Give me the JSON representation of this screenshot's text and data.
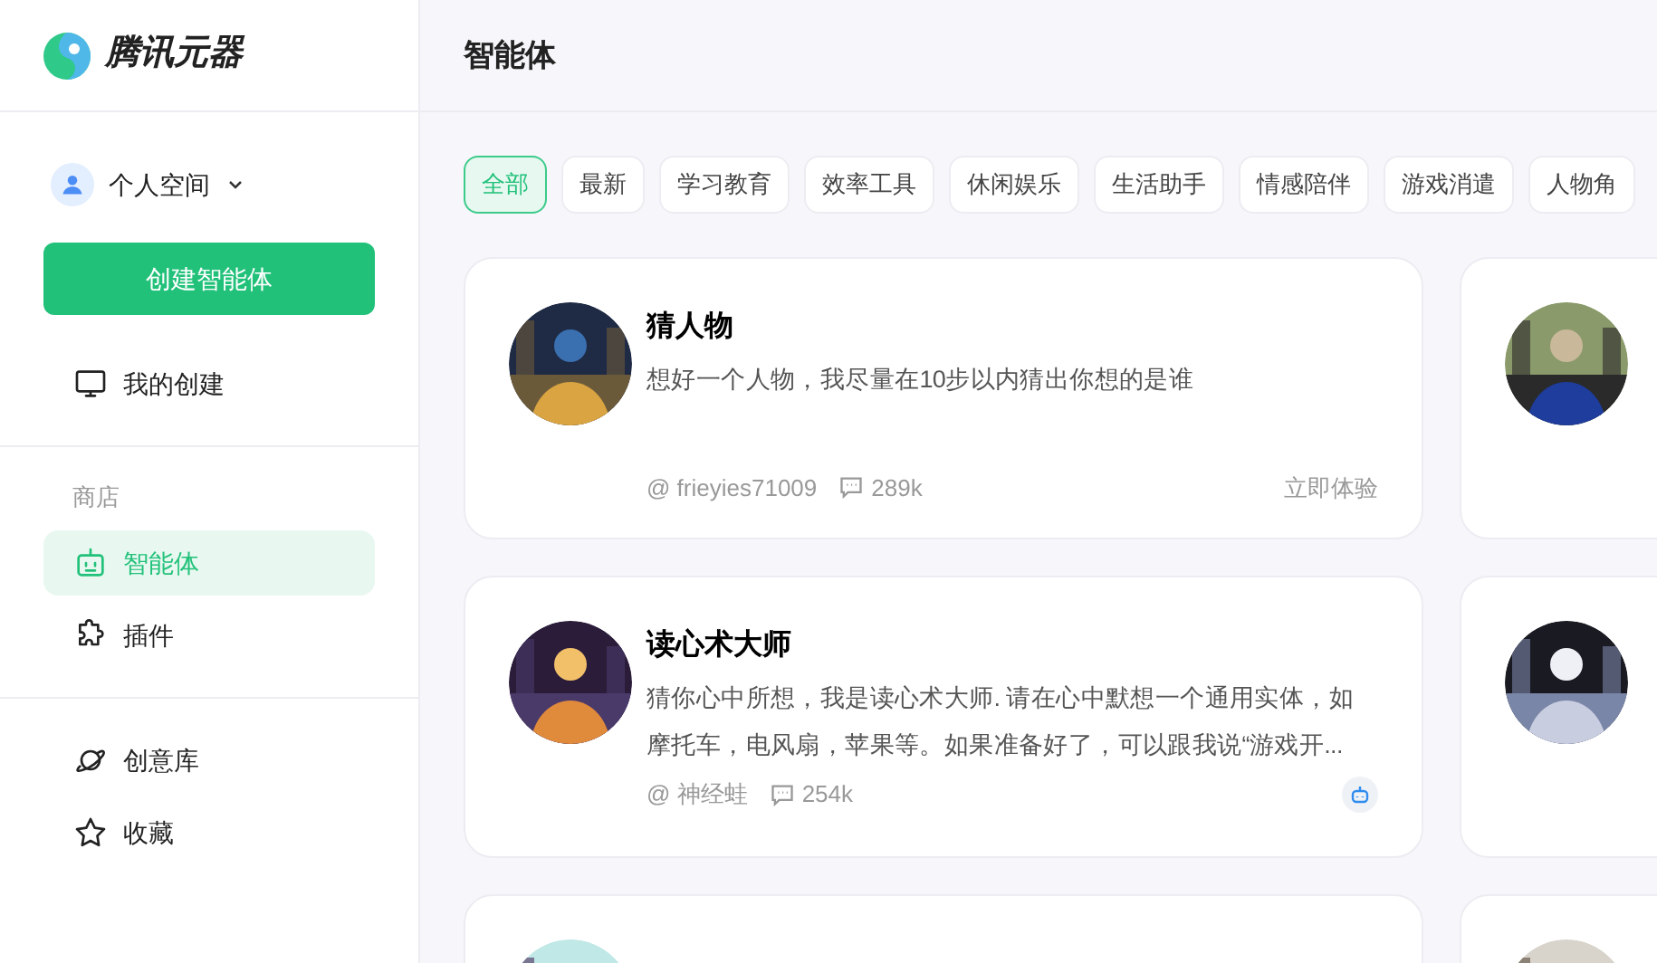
{
  "brand": {
    "name": "腾讯元器"
  },
  "workspace": {
    "label": "个人空间"
  },
  "create_button": "创建智能体",
  "nav_top": [
    {
      "label": "我的创建",
      "selected": false
    }
  ],
  "store": {
    "heading": "商店",
    "items": [
      {
        "label": "智能体",
        "selected": true
      },
      {
        "label": "插件",
        "selected": false
      }
    ]
  },
  "nav_bottom": [
    {
      "label": "创意库",
      "selected": false
    },
    {
      "label": "收藏",
      "selected": false
    }
  ],
  "page_title": "智能体",
  "tags": [
    {
      "label": "全部",
      "selected": true
    },
    {
      "label": "最新",
      "selected": false
    },
    {
      "label": "学习教育",
      "selected": false
    },
    {
      "label": "效率工具",
      "selected": false
    },
    {
      "label": "休闲娱乐",
      "selected": false
    },
    {
      "label": "生活助手",
      "selected": false
    },
    {
      "label": "情感陪伴",
      "selected": false
    },
    {
      "label": "游戏消遣",
      "selected": false
    },
    {
      "label": "人物角",
      "selected": false
    }
  ],
  "cards": [
    {
      "kind": "agent",
      "title": "猜人物",
      "description": "想好一个人物，我尽量在10步以内猜出你想的是谁",
      "author": "@ frieyies71009",
      "count": "289k",
      "action": {
        "kind": "link",
        "label": "立即体验"
      }
    },
    {
      "kind": "picture"
    },
    {
      "kind": "agent",
      "title": "读心术大师",
      "description": "猜你心中所想，我是读心术大师. 请在心中默想一个通用实体，如摩托车，电风扇，苹果等。如果准备好了，可以跟我说“游戏开...",
      "author": "@ 神经蛙",
      "count": "254k",
      "action": {
        "kind": "bot"
      }
    },
    {
      "kind": "picture"
    },
    {
      "kind": "picture"
    },
    {
      "kind": "picture"
    }
  ]
}
